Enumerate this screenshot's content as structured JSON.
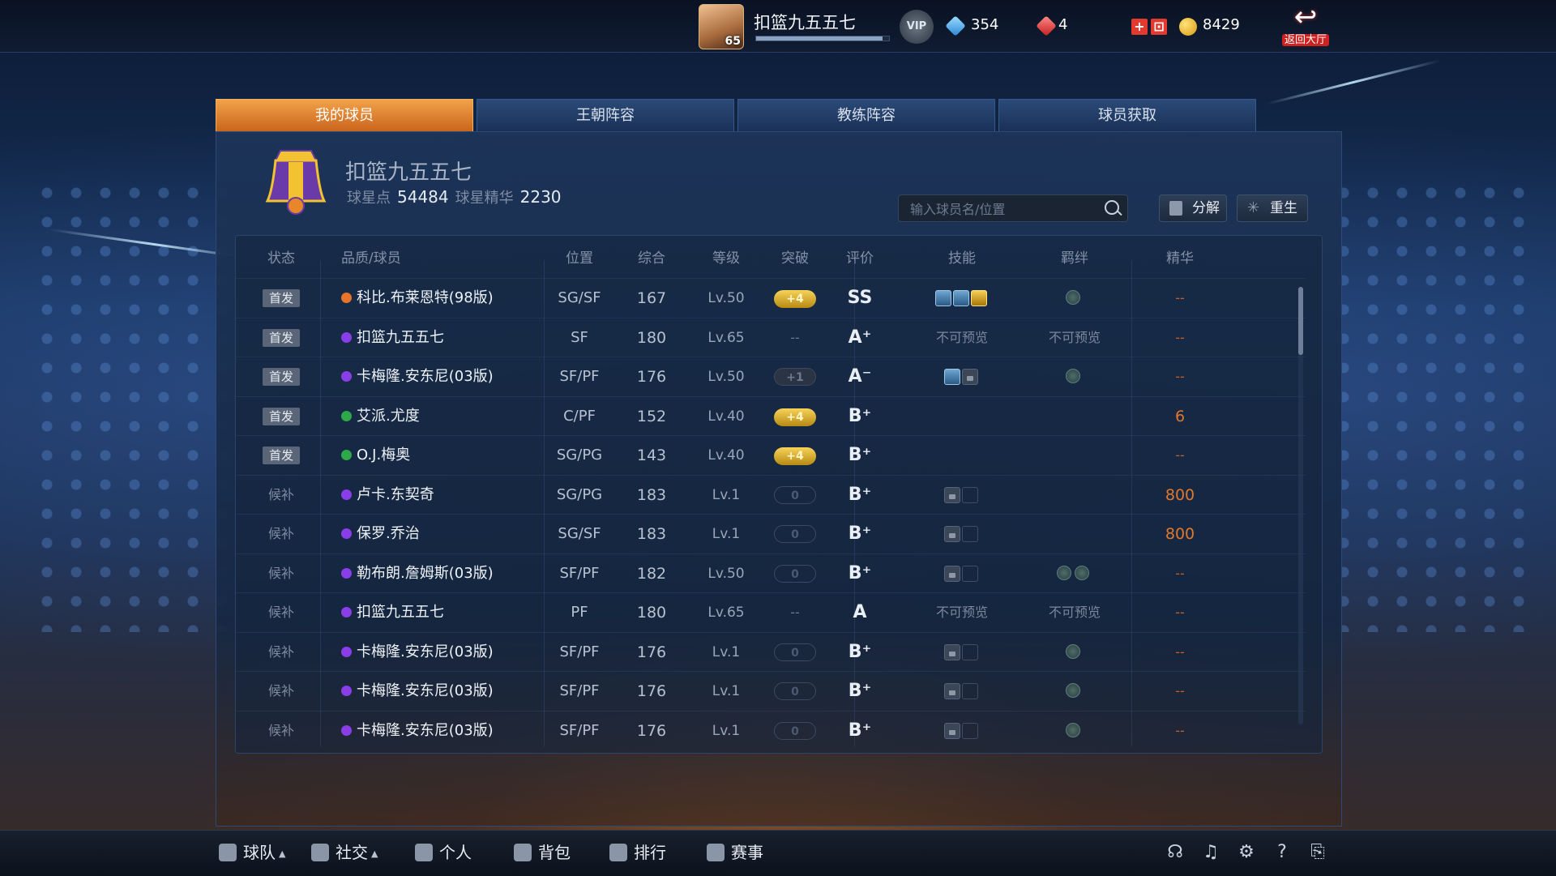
{
  "player": {
    "name": "扣篮九五五七",
    "level": "65",
    "xp_fraction": 0.95
  },
  "vip_label": "VIP",
  "resources": {
    "diamonds": "354",
    "tickets": "4",
    "coins": "8429"
  },
  "back_button": {
    "label": "返回大厅"
  },
  "tabs": [
    "我的球员",
    "王朝阵容",
    "教练阵容",
    "球员获取"
  ],
  "active_tab": 0,
  "team": {
    "name": "扣篮九五五七",
    "star_points_label": "球星点",
    "star_points": "54484",
    "essence_label": "球星精华",
    "essence": "2230"
  },
  "search": {
    "placeholder": "输入球员名/位置"
  },
  "actions": {
    "decompose": "分解",
    "rebirth": "重生"
  },
  "columns": [
    "状态",
    "品质/球员",
    "位置",
    "综合",
    "等级",
    "突破",
    "评价",
    "技能",
    "羁绊",
    "精华"
  ],
  "colors": {
    "orange": "#e8732a",
    "purple": "#8a3ee8",
    "green": "#2fa84a",
    "accent": "#f0a040"
  },
  "rows": [
    {
      "status": "首发",
      "starter": true,
      "quality": "orange",
      "name": "科比.布莱恩特(98版)",
      "pos": "SG/SF",
      "ovr": "167",
      "lv": "Lv.50",
      "brk": "+4",
      "brk_style": "gold",
      "grade": "SS",
      "skills": [
        "a",
        "a",
        "g"
      ],
      "skill_note": "",
      "bonds": 1,
      "bond_note": "",
      "essence": "--"
    },
    {
      "status": "首发",
      "starter": true,
      "quality": "purple",
      "name": "扣篮九五五七",
      "pos": "SF",
      "ovr": "180",
      "lv": "Lv.65",
      "brk": "--",
      "brk_style": "dash",
      "grade": "A⁺",
      "skills": [],
      "skill_note": "不可预览",
      "bonds": 0,
      "bond_note": "不可预览",
      "essence": "--"
    },
    {
      "status": "首发",
      "starter": true,
      "quality": "purple",
      "name": "卡梅隆.安东尼(03版)",
      "pos": "SF/PF",
      "ovr": "176",
      "lv": "Lv.50",
      "brk": "+1",
      "brk_style": "dark",
      "grade": "A⁻",
      "skills": [
        "a",
        "lock"
      ],
      "skill_note": "",
      "bonds": 1,
      "bond_note": "",
      "essence": "--"
    },
    {
      "status": "首发",
      "starter": true,
      "quality": "green",
      "name": "艾派.尤度",
      "pos": "C/PF",
      "ovr": "152",
      "lv": "Lv.40",
      "brk": "+4",
      "brk_style": "gold",
      "grade": "B⁺",
      "skills": [],
      "skill_note": "",
      "bonds": 0,
      "bond_note": "",
      "essence": "6"
    },
    {
      "status": "首发",
      "starter": true,
      "quality": "green",
      "name": "O.J.梅奥",
      "pos": "SG/PG",
      "ovr": "143",
      "lv": "Lv.40",
      "brk": "+4",
      "brk_style": "gold",
      "grade": "B⁺",
      "skills": [],
      "skill_note": "",
      "bonds": 0,
      "bond_note": "",
      "essence": "--"
    },
    {
      "status": "候补",
      "starter": false,
      "quality": "purple",
      "name": "卢卡.东契奇",
      "pos": "SG/PG",
      "ovr": "183",
      "lv": "Lv.1",
      "brk": "0",
      "brk_style": "empty",
      "grade": "B⁺",
      "skills": [
        "lock",
        "blank"
      ],
      "skill_note": "",
      "bonds": 0,
      "bond_note": "",
      "essence": "800"
    },
    {
      "status": "候补",
      "starter": false,
      "quality": "purple",
      "name": "保罗.乔治",
      "pos": "SG/SF",
      "ovr": "183",
      "lv": "Lv.1",
      "brk": "0",
      "brk_style": "empty",
      "grade": "B⁺",
      "skills": [
        "lock",
        "blank"
      ],
      "skill_note": "",
      "bonds": 0,
      "bond_note": "",
      "essence": "800"
    },
    {
      "status": "候补",
      "starter": false,
      "quality": "purple",
      "name": "勒布朗.詹姆斯(03版)",
      "pos": "SF/PF",
      "ovr": "182",
      "lv": "Lv.50",
      "brk": "0",
      "brk_style": "empty",
      "grade": "B⁺",
      "skills": [
        "lock",
        "blank"
      ],
      "skill_note": "",
      "bonds": 2,
      "bond_note": "",
      "essence": "--"
    },
    {
      "status": "候补",
      "starter": false,
      "quality": "purple",
      "name": "扣篮九五五七",
      "pos": "PF",
      "ovr": "180",
      "lv": "Lv.65",
      "brk": "--",
      "brk_style": "dash",
      "grade": "A",
      "skills": [],
      "skill_note": "不可预览",
      "bonds": 0,
      "bond_note": "不可预览",
      "essence": "--"
    },
    {
      "status": "候补",
      "starter": false,
      "quality": "purple",
      "name": "卡梅隆.安东尼(03版)",
      "pos": "SF/PF",
      "ovr": "176",
      "lv": "Lv.1",
      "brk": "0",
      "brk_style": "empty",
      "grade": "B⁺",
      "skills": [
        "lock",
        "blank"
      ],
      "skill_note": "",
      "bonds": 1,
      "bond_note": "",
      "essence": "--"
    },
    {
      "status": "候补",
      "starter": false,
      "quality": "purple",
      "name": "卡梅隆.安东尼(03版)",
      "pos": "SF/PF",
      "ovr": "176",
      "lv": "Lv.1",
      "brk": "0",
      "brk_style": "empty",
      "grade": "B⁺",
      "skills": [
        "lock",
        "blank"
      ],
      "skill_note": "",
      "bonds": 1,
      "bond_note": "",
      "essence": "--"
    },
    {
      "status": "候补",
      "starter": false,
      "quality": "purple",
      "name": "卡梅隆.安东尼(03版)",
      "pos": "SF/PF",
      "ovr": "176",
      "lv": "Lv.1",
      "brk": "0",
      "brk_style": "empty",
      "grade": "B⁺",
      "skills": [
        "lock",
        "blank"
      ],
      "skill_note": "",
      "bonds": 1,
      "bond_note": "",
      "essence": "--"
    }
  ],
  "bottom_nav": [
    {
      "label": "球队",
      "caret": true,
      "icon": "team-icon"
    },
    {
      "label": "社交",
      "caret": true,
      "icon": "social-icon"
    },
    {
      "label": "个人",
      "caret": false,
      "icon": "person-icon"
    },
    {
      "label": "背包",
      "caret": false,
      "icon": "backpack-icon"
    },
    {
      "label": "排行",
      "caret": false,
      "icon": "ranking-icon"
    },
    {
      "label": "赛事",
      "caret": false,
      "icon": "trophy-icon"
    }
  ],
  "system_icons": [
    "headset-icon",
    "music-icon",
    "settings-icon",
    "help-icon",
    "exit-icon"
  ]
}
